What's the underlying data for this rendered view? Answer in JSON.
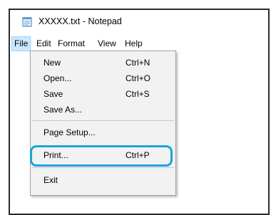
{
  "window": {
    "title": "XXXXX.txt - Notepad",
    "icon": "notepad-icon"
  },
  "menubar": {
    "items": [
      "File",
      "Edit",
      "Format",
      "View",
      "Help"
    ],
    "active": "File"
  },
  "file_menu": {
    "items": [
      {
        "label": "New",
        "shortcut": "Ctrl+N"
      },
      {
        "label": "Open...",
        "shortcut": "Ctrl+O"
      },
      {
        "label": "Save",
        "shortcut": "Ctrl+S"
      },
      {
        "label": "Save As...",
        "shortcut": ""
      },
      {
        "label": "Page Setup...",
        "shortcut": ""
      },
      {
        "label": "Print...",
        "shortcut": "Ctrl+P"
      },
      {
        "label": "Exit",
        "shortcut": ""
      }
    ],
    "highlighted_item": "Print..."
  },
  "colors": {
    "highlight": "#1aa3e0",
    "menu_active_bg": "#cce8ff"
  }
}
